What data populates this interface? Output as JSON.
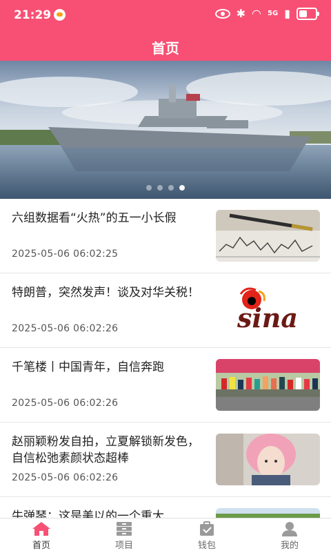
{
  "status_bar": {
    "time": "21:29",
    "network": "5G"
  },
  "header": {
    "title": "首页"
  },
  "banner": {
    "slide_count": 4,
    "active_index": 3
  },
  "news": [
    {
      "title": "六组数据看“火热”的五一小长假",
      "date": "2025-05-06 06:02:25",
      "thumb": "finance-chart-pen"
    },
    {
      "title": "特朗普，突然发声！谈及对华关税！",
      "date": "2025-05-06 06:02:26",
      "thumb": "sina-logo"
    },
    {
      "title": "千笔楼丨中国青年，自信奔跑",
      "date": "2025-05-06 06:02:26",
      "thumb": "marathon-runners"
    },
    {
      "title": "赵丽颖粉发自拍，立夏解锁新发色，自信松弛素颜状态超棒",
      "date": "2025-05-06 06:02:26",
      "thumb": "pink-hair-portrait"
    },
    {
      "title": "牛弹琴：这是美以的一个重大",
      "date": "",
      "thumb": "landscape"
    }
  ],
  "thumb_logo_text": "sina",
  "bottom_nav": [
    {
      "label": "首页",
      "icon": "home-icon",
      "active": true
    },
    {
      "label": "项目",
      "icon": "list-icon",
      "active": false
    },
    {
      "label": "钱包",
      "icon": "wallet-icon",
      "active": false
    },
    {
      "label": "我的",
      "icon": "profile-icon",
      "active": false
    }
  ],
  "colors": {
    "brand": "#f85074",
    "active_nav": "#f85074",
    "inactive_nav": "#999999"
  }
}
